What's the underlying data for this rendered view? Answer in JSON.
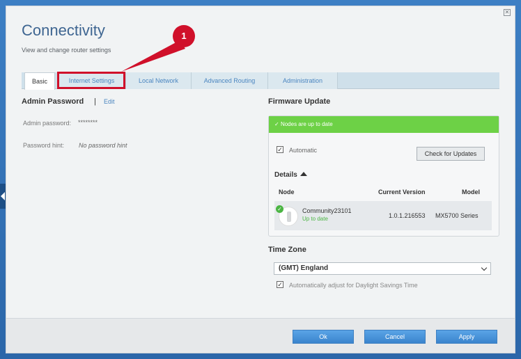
{
  "header": {
    "title": "Connectivity",
    "subtitle": "View and change router settings"
  },
  "tabs": [
    {
      "label": "Basic",
      "active": true
    },
    {
      "label": "Internet Settings",
      "active": false
    },
    {
      "label": "Local Network",
      "active": false
    },
    {
      "label": "Advanced Routing",
      "active": false
    },
    {
      "label": "Administration",
      "active": false
    }
  ],
  "callout": {
    "number": "1",
    "color": "#d0102a"
  },
  "admin": {
    "heading": "Admin Password",
    "separator": "|",
    "edit_label": "Edit",
    "password_label": "Admin password:",
    "password_value": "********",
    "hint_label": "Password hint:",
    "hint_value": "No password hint"
  },
  "firmware": {
    "heading": "Firmware Update",
    "banner": "Nodes are up to date",
    "automatic_label": "Automatic",
    "automatic_checked": true,
    "check_button": "Check for Updates",
    "details_label": "Details",
    "columns": {
      "node": "Node",
      "version": "Current Version",
      "model": "Model"
    },
    "node": {
      "name": "Community23101",
      "status": "Up to date",
      "version": "1.0.1.216553",
      "model": "MX5700 Series"
    }
  },
  "timezone": {
    "heading": "Time Zone",
    "selected": "(GMT) England",
    "dst_label": "Automatically adjust for Daylight Savings Time",
    "dst_checked": true
  },
  "footer": {
    "ok": "Ok",
    "cancel": "Cancel",
    "apply": "Apply"
  },
  "colors": {
    "accent": "#4b86c0",
    "success": "#6dd146",
    "primary_button": "#3a84cd"
  }
}
